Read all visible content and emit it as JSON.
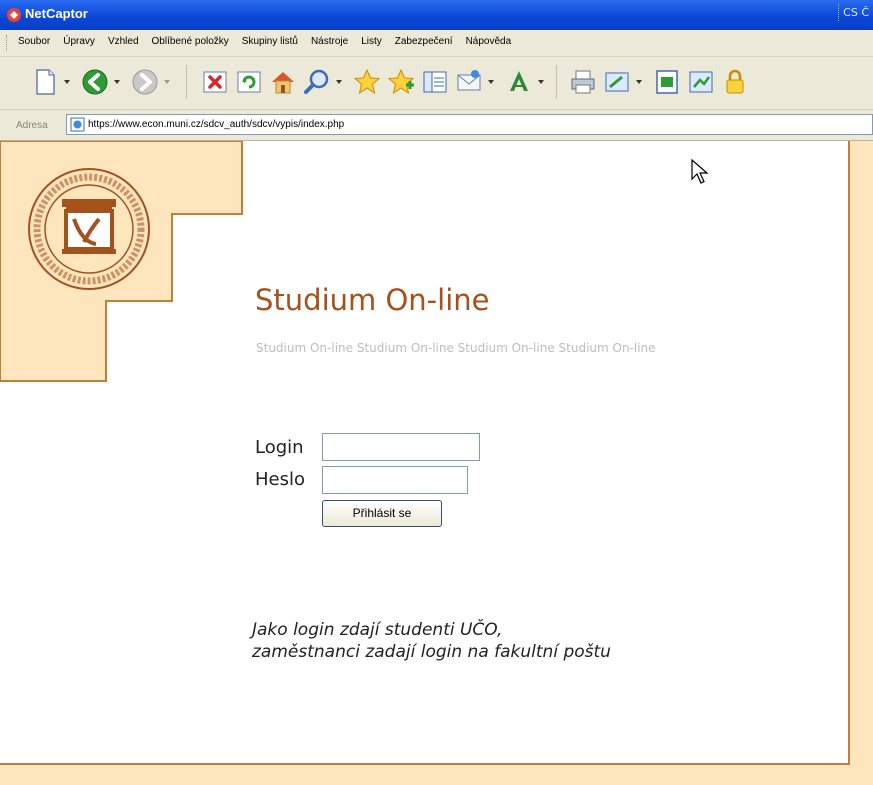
{
  "window": {
    "title": "NetCaptor",
    "language_indicator": "CS Č"
  },
  "menu": {
    "items": [
      "Soubor",
      "Úpravy",
      "Vzhled",
      "Oblíbené položky",
      "Skupiny listů",
      "Nástroje",
      "Listy",
      "Zabezpečení",
      "Nápověda"
    ]
  },
  "toolbar": {
    "buttons": [
      "new-page",
      "back",
      "forward",
      "stop",
      "refresh",
      "home",
      "search",
      "favorites",
      "add-favorite",
      "history",
      "mail",
      "font",
      "print",
      "edit",
      "page",
      "sync",
      "security"
    ]
  },
  "address": {
    "label": "Adresa",
    "url": "https://www.econ.muni.cz/sdcv_auth/sdcv/vypis/index.php"
  },
  "page": {
    "heading": "Studium On-line",
    "subheading": "Studium On-line Studium On-line Studium On-line Studium On-line",
    "login_label": "Login",
    "password_label": "Heslo",
    "login_value": "",
    "password_value": "",
    "submit_label": "Přihlásit se",
    "note_line1": "Jako login zdají studenti UČO,",
    "note_line2": "zaměstnanci zadají login na fakultní poštu"
  },
  "colors": {
    "accent": "#a4511c",
    "panel": "#fde5bd",
    "panel_border": "#c17f3a",
    "titlebar": "#0a46d6"
  }
}
